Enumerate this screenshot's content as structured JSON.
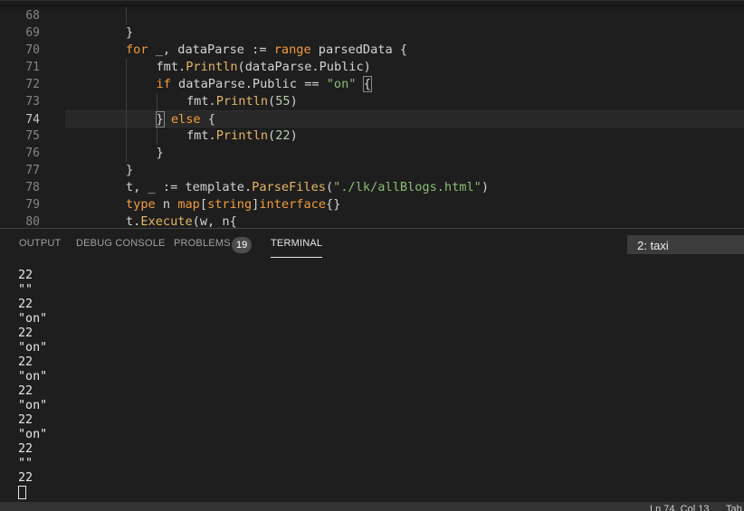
{
  "editor": {
    "lines": [
      {
        "num": "68",
        "indent": 0,
        "tokens": []
      },
      {
        "num": "69",
        "indent": 0,
        "tokens": [
          {
            "t": "}",
            "c": "pl"
          }
        ]
      },
      {
        "num": "70",
        "indent": 0,
        "tokens": [
          {
            "t": "for",
            "c": "kw"
          },
          {
            "t": " _, dataParse := ",
            "c": "pl"
          },
          {
            "t": "range",
            "c": "kw"
          },
          {
            "t": " parsedData {",
            "c": "pl"
          }
        ]
      },
      {
        "num": "71",
        "indent": 1,
        "tokens": [
          {
            "t": "fmt.",
            "c": "pl"
          },
          {
            "t": "Println",
            "c": "fn"
          },
          {
            "t": "(dataParse.Public)",
            "c": "pl"
          }
        ]
      },
      {
        "num": "72",
        "indent": 1,
        "tokens": [
          {
            "t": "if",
            "c": "kw"
          },
          {
            "t": " dataParse.Public == ",
            "c": "pl"
          },
          {
            "t": "\"on\"",
            "c": "str"
          },
          {
            "t": " ",
            "c": "pl"
          },
          {
            "t": "{",
            "c": "pl",
            "match": true
          }
        ]
      },
      {
        "num": "73",
        "indent": 2,
        "tokens": [
          {
            "t": "fmt.",
            "c": "pl"
          },
          {
            "t": "Println",
            "c": "fn"
          },
          {
            "t": "(",
            "c": "pl"
          },
          {
            "t": "55",
            "c": "num"
          },
          {
            "t": ")",
            "c": "pl"
          }
        ]
      },
      {
        "num": "74",
        "indent": 1,
        "current": true,
        "tokens": [
          {
            "t": "}",
            "c": "pl",
            "match": true
          },
          {
            "t": " ",
            "c": "pl"
          },
          {
            "t": "else",
            "c": "kw"
          },
          {
            "t": " {",
            "c": "pl"
          }
        ]
      },
      {
        "num": "75",
        "indent": 2,
        "tokens": [
          {
            "t": "fmt.",
            "c": "pl"
          },
          {
            "t": "Println",
            "c": "fn"
          },
          {
            "t": "(",
            "c": "pl"
          },
          {
            "t": "22",
            "c": "num"
          },
          {
            "t": ")",
            "c": "pl"
          }
        ]
      },
      {
        "num": "76",
        "indent": 1,
        "tokens": [
          {
            "t": "}",
            "c": "pl"
          }
        ]
      },
      {
        "num": "77",
        "indent": 0,
        "tokens": [
          {
            "t": "}",
            "c": "pl"
          }
        ]
      },
      {
        "num": "78",
        "indent": 0,
        "tokens": [
          {
            "t": "t, _ := template.",
            "c": "pl"
          },
          {
            "t": "ParseFiles",
            "c": "fn"
          },
          {
            "t": "(",
            "c": "pl"
          },
          {
            "t": "\"./lk/allBlogs.html\"",
            "c": "str"
          },
          {
            "t": ")",
            "c": "pl"
          }
        ]
      },
      {
        "num": "79",
        "indent": 0,
        "tokens": [
          {
            "t": "type",
            "c": "kw"
          },
          {
            "t": " n ",
            "c": "pl"
          },
          {
            "t": "map",
            "c": "kw"
          },
          {
            "t": "[",
            "c": "pl"
          },
          {
            "t": "string",
            "c": "type"
          },
          {
            "t": "]",
            "c": "pl"
          },
          {
            "t": "interface",
            "c": "kw"
          },
          {
            "t": "{}",
            "c": "pl"
          }
        ]
      },
      {
        "num": "80",
        "indent": 0,
        "tokens": [
          {
            "t": "t.",
            "c": "pl"
          },
          {
            "t": "Execute",
            "c": "fn"
          },
          {
            "t": "(w, n{",
            "c": "pl"
          }
        ]
      }
    ]
  },
  "panel": {
    "tabs": {
      "output": "OUTPUT",
      "debug_console": "DEBUG CONSOLE",
      "problems": "PROBLEMS",
      "terminal": "TERMINAL"
    },
    "problems_count": "19",
    "terminal_select": "2: taxi"
  },
  "terminal": {
    "lines": [
      "22",
      "\"\"",
      "22",
      "\"on\"",
      "22",
      "\"on\"",
      "22",
      "\"on\"",
      "22",
      "\"on\"",
      "22",
      "\"on\"",
      "22",
      "\"\"",
      "22"
    ]
  },
  "status": {
    "position": "Ln 74, Col 13",
    "tab": "Tab"
  }
}
